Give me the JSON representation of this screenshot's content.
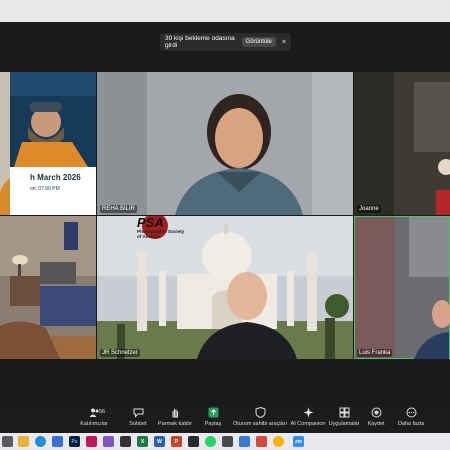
{
  "notice": {
    "text": "30 kişi bekleme odasına girdi",
    "view": "Görüntüle",
    "close": "×"
  },
  "tiles": {
    "reha": {
      "name": "REHA BİLİR"
    },
    "joanne": {
      "name": "Joanne"
    },
    "jr": {
      "name": "JR Schnelzer"
    },
    "luis": {
      "name": "Luis Franka"
    }
  },
  "poster": {
    "date_line": "h March 2026",
    "time_line": "on: 07:00 PM"
  },
  "psa": {
    "logo_text": "PSA",
    "subtitle": "Photographic Society of America"
  },
  "toolbar": {
    "participants_count": "56",
    "participants": "Katılımcılar",
    "chat": "Sohbet",
    "raise_hand": "Parmak kaldır",
    "share": "Paylaş",
    "host_tools": "Oturum sahibi araçları",
    "ai": "AI Companion",
    "apps": "Uygulamalar",
    "record": "Kaydet",
    "more": "Daha fazla"
  },
  "taskbar": {
    "ps": "Ps",
    "zoom": "zm",
    "x": "X",
    "w": "W",
    "p": "P"
  }
}
